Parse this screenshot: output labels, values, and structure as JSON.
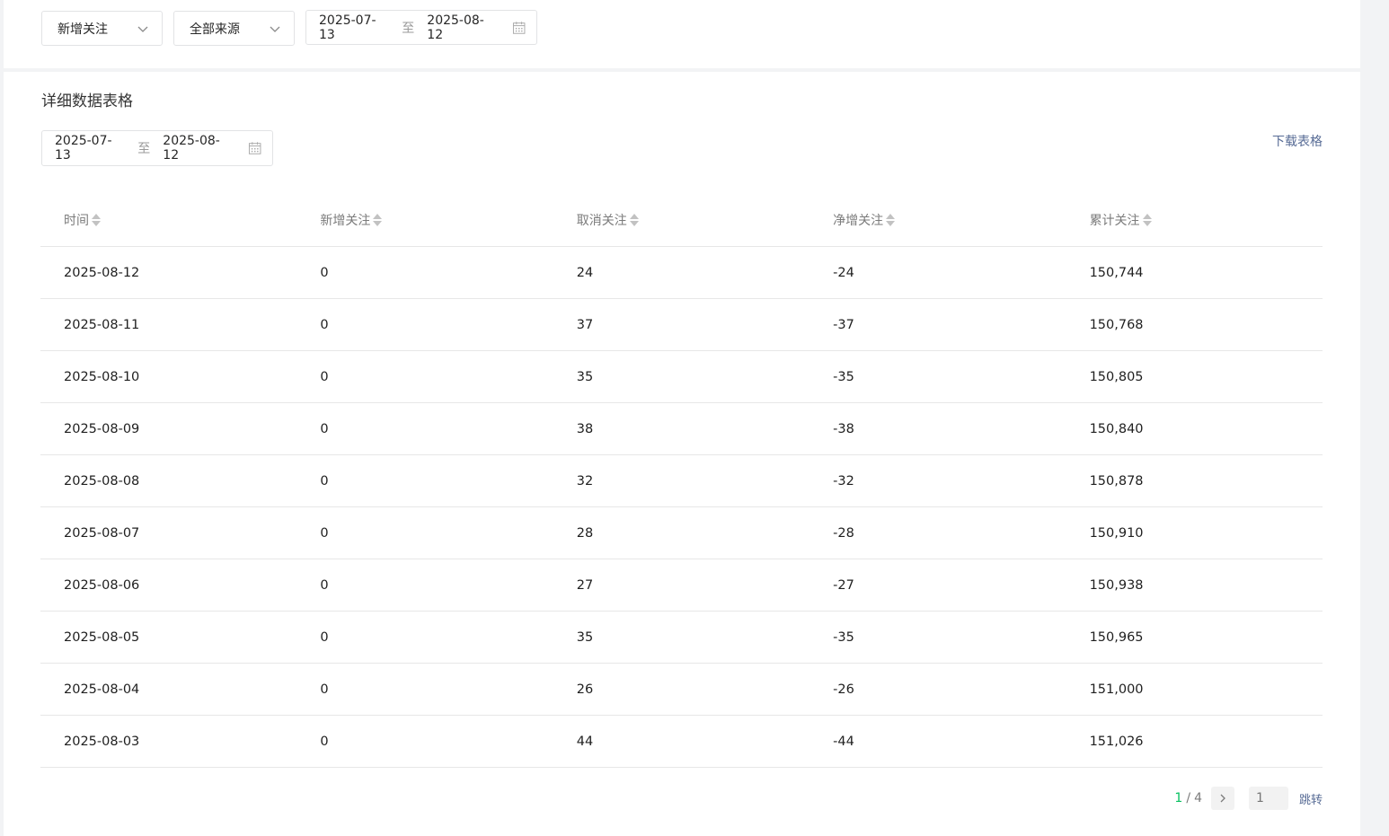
{
  "filters": {
    "metric_select": "新增关注",
    "source_select": "全部来源",
    "date_range": {
      "start": "2025-07-13",
      "separator": "至",
      "end": "2025-08-12"
    }
  },
  "detail": {
    "title": "详细数据表格",
    "date_range": {
      "start": "2025-07-13",
      "separator": "至",
      "end": "2025-08-12"
    },
    "download_label": "下载表格"
  },
  "table": {
    "columns": [
      "时间",
      "新增关注",
      "取消关注",
      "净增关注",
      "累计关注"
    ],
    "rows": [
      [
        "2025-08-12",
        "0",
        "24",
        "-24",
        "150,744"
      ],
      [
        "2025-08-11",
        "0",
        "37",
        "-37",
        "150,768"
      ],
      [
        "2025-08-10",
        "0",
        "35",
        "-35",
        "150,805"
      ],
      [
        "2025-08-09",
        "0",
        "38",
        "-38",
        "150,840"
      ],
      [
        "2025-08-08",
        "0",
        "32",
        "-32",
        "150,878"
      ],
      [
        "2025-08-07",
        "0",
        "28",
        "-28",
        "150,910"
      ],
      [
        "2025-08-06",
        "0",
        "27",
        "-27",
        "150,938"
      ],
      [
        "2025-08-05",
        "0",
        "35",
        "-35",
        "150,965"
      ],
      [
        "2025-08-04",
        "0",
        "26",
        "-26",
        "151,000"
      ],
      [
        "2025-08-03",
        "0",
        "44",
        "-44",
        "151,026"
      ]
    ]
  },
  "pagination": {
    "current": "1",
    "separator": "/",
    "total": "4",
    "page_input_placeholder": "1",
    "jump_label": "跳转"
  },
  "colors": {
    "accent": "#07c160",
    "link": "#576b95"
  }
}
